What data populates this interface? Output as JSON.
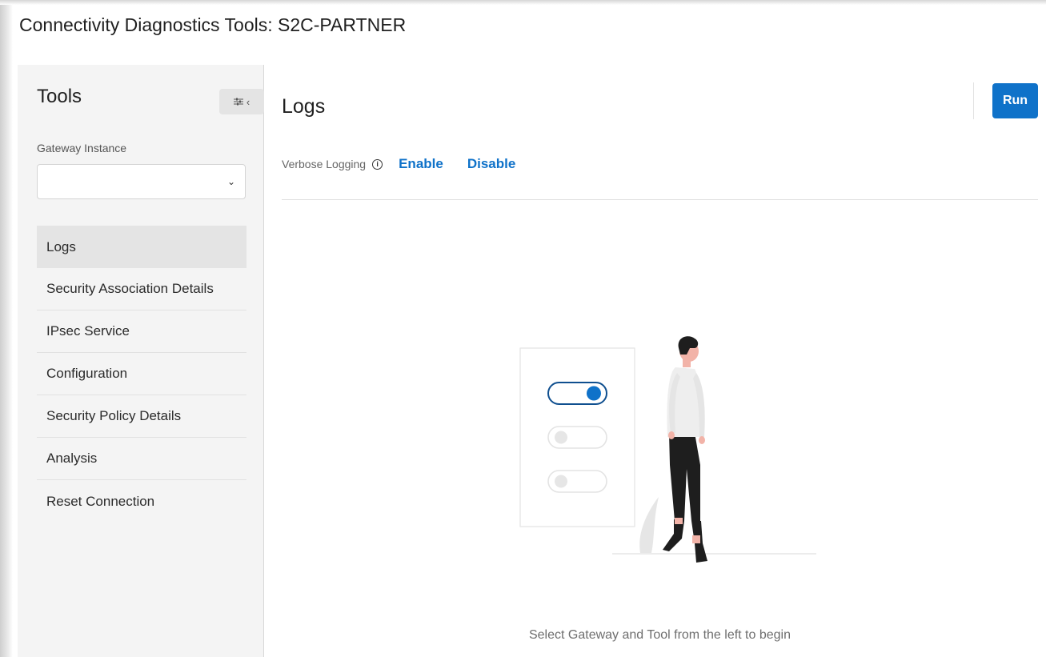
{
  "page": {
    "title": "Connectivity Diagnostics Tools: S2C-PARTNER"
  },
  "sidebar": {
    "title": "Tools",
    "collapse_icon": "sliders-collapse-icon",
    "gateway_label": "Gateway Instance",
    "gateway_value": "",
    "items": [
      {
        "label": "Logs",
        "active": true
      },
      {
        "label": "Security Association Details",
        "active": false
      },
      {
        "label": "IPsec Service",
        "active": false
      },
      {
        "label": "Configuration",
        "active": false
      },
      {
        "label": "Security Policy Details",
        "active": false
      },
      {
        "label": "Analysis",
        "active": false
      },
      {
        "label": "Reset Connection",
        "active": false
      }
    ]
  },
  "main": {
    "title": "Logs",
    "run_label": "Run",
    "verbose_label": "Verbose Logging",
    "enable_label": "Enable",
    "disable_label": "Disable",
    "empty_message": "Select Gateway and Tool from the left to begin"
  },
  "colors": {
    "accent": "#0f72c9",
    "sidebar_bg": "#f4f4f4",
    "active_item": "#e4e4e4"
  }
}
